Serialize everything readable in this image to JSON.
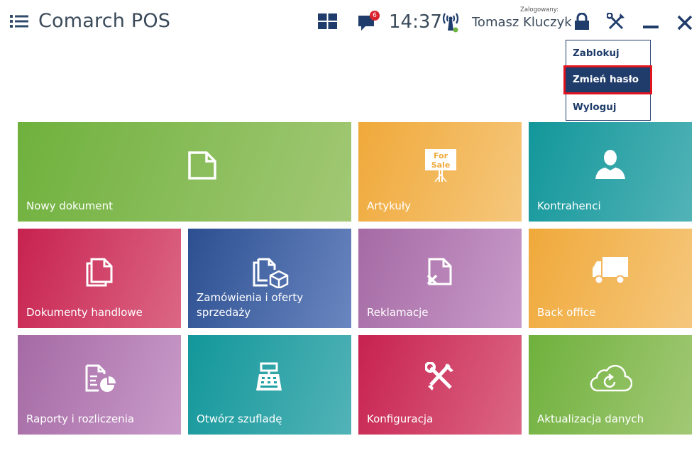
{
  "header": {
    "app_title": "Comarch POS",
    "notification_count": "6",
    "clock": "14:37",
    "logged_label": "Zalogowany:",
    "user_name": "Tomasz Kluczyk"
  },
  "dropdown": {
    "items": [
      {
        "label": "Zablokuj"
      },
      {
        "label": "Zmień hasło"
      },
      {
        "label": "Wyloguj"
      }
    ],
    "selected_index": 1
  },
  "tiles": [
    {
      "label": "Nowy dokument",
      "icon": "document-icon"
    },
    {
      "label": "Artykuły",
      "icon": "for-sale-sign-icon",
      "icon_text_1": "For",
      "icon_text_2": "Sale"
    },
    {
      "label": "Kontrahenci",
      "icon": "person-icon"
    },
    {
      "label": "Dokumenty handlowe",
      "icon": "documents-icon"
    },
    {
      "label_line1": "Zamówienia i oferty",
      "label_line2": "sprzedaży",
      "icon": "document-box-icon"
    },
    {
      "label": "Reklamacje",
      "icon": "document-x-icon"
    },
    {
      "label": "Back office",
      "icon": "truck-icon"
    },
    {
      "label": "Raporty i rozliczenia",
      "icon": "report-icon"
    },
    {
      "label": "Otwórz szufladę",
      "icon": "cash-register-icon"
    },
    {
      "label": "Konfiguracja",
      "icon": "tools-icon"
    },
    {
      "label": "Aktualizacja danych",
      "icon": "cloud-refresh-icon"
    }
  ],
  "colors": {
    "header_text": "#3a4a5a",
    "menu_accent": "#1f3c6b",
    "highlight": "#e0141e",
    "badge": "#d9232d"
  }
}
